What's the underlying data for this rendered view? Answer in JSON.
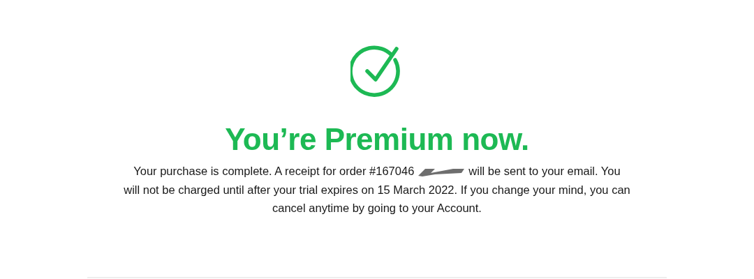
{
  "title": "You’re Premium now.",
  "message_lines": [
    {
      "before": "Your purchase is complete. A receipt for order #167046",
      "after": "will be sent to your email. You"
    },
    {
      "text": "will not be charged until after your trial expires on 15 March 2022. If you change your mind, you can"
    },
    {
      "text": "cancel anytime by going to your Account."
    }
  ]
}
